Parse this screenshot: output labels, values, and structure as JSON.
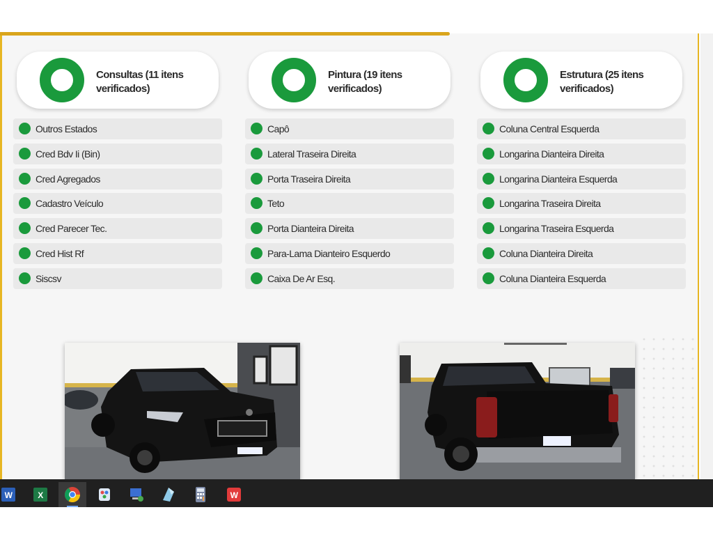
{
  "sections": [
    {
      "title": "Consultas (11 itens verificados)",
      "items": [
        "Outros Estados",
        "Cred Bdv Ii (Bin)",
        "Cred Agregados",
        "Cadastro Veículo",
        "Cred Parecer Tec.",
        "Cred Hist Rf",
        "Siscsv"
      ]
    },
    {
      "title": "Pintura (19 itens verificados)",
      "items": [
        "Capô",
        "Lateral Traseira Direita",
        "Porta Traseira Direita",
        "Teto",
        "Porta Dianteira Direita",
        "Para-Lama Dianteiro Esquerdo",
        "Caixa De Ar Esq."
      ]
    },
    {
      "title": "Estrutura (25 itens verificados)",
      "items": [
        "Coluna Central Esquerda",
        "Longarina Dianteira Direita",
        "Longarina Dianteira Esquerda",
        "Longarina Traseira Direita",
        "Longarina Traseira Esquerda",
        "Coluna Dianteira Direita",
        "Coluna Dianteira Esquerda"
      ]
    }
  ],
  "photos": [
    {
      "name": "front-three-quarter",
      "plate_visible": true
    },
    {
      "name": "rear-three-quarter",
      "plate_visible": true
    }
  ],
  "taskbar": {
    "apps": [
      "word-icon",
      "excel-icon",
      "chrome-icon",
      "paint-icon",
      "network-icon",
      "snip-icon",
      "calculator-icon",
      "wps-icon"
    ],
    "active": "chrome-icon"
  },
  "colors": {
    "accent": "#e7b623",
    "status_ok": "#1a9a3c",
    "item_bg": "#e9e9e9",
    "taskbar_bg": "#202020"
  }
}
